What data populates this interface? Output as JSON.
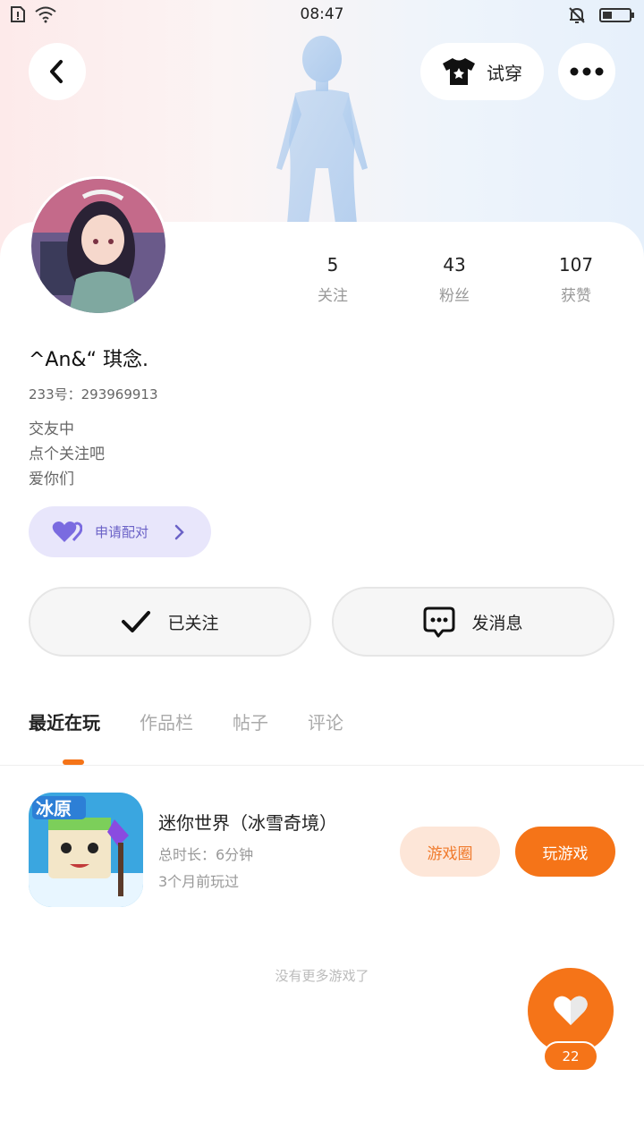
{
  "status_bar": {
    "time": "08:47",
    "icons": [
      "sim-icon",
      "wifi-icon",
      "mute-bell-icon",
      "battery-icon"
    ],
    "battery_level": 0.35
  },
  "header": {
    "try_on_label": "试穿",
    "back_icon": "back-arrow-icon",
    "more_icon": "more-dots-icon",
    "try_on_icon": "tshirt-icon"
  },
  "profile": {
    "name": "^An&“ 琪念.",
    "uid": "233号：293969913",
    "bio": [
      "交友中",
      "点个关注吧",
      "爱你们"
    ],
    "stats": [
      {
        "value": "5",
        "label": "关注"
      },
      {
        "value": "43",
        "label": "粉丝"
      },
      {
        "value": "107",
        "label": "获赞"
      }
    ],
    "pair_label": "申请配对"
  },
  "actions": {
    "following_label": "已关注",
    "message_label": "发消息"
  },
  "tabs": [
    {
      "label": "最近在玩",
      "active": true
    },
    {
      "label": "作品栏",
      "active": false
    },
    {
      "label": "帖子",
      "active": false
    },
    {
      "label": "评论",
      "active": false
    }
  ],
  "game": {
    "title": "迷你世界（冰雪奇境）",
    "duration": "总时长：6分钟",
    "last_played": "3个月前玩过",
    "icon_text": "冰原",
    "circle_label": "游戏圈",
    "play_label": "玩游戏"
  },
  "no_more_text": "没有更多游戏了",
  "like": {
    "count": "22"
  },
  "colors": {
    "accent": "#f57418",
    "pair_bg": "#e8e6fb",
    "pair_text": "#6b62c7"
  }
}
